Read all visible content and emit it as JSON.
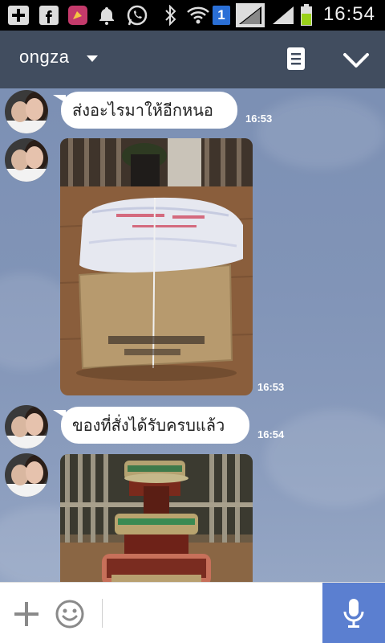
{
  "status_bar": {
    "time": "16:54",
    "notification_badge": "1",
    "icons": [
      "add-icon",
      "facebook-icon",
      "app-icon",
      "bell-icon",
      "whatsapp-icon",
      "bluetooth-icon",
      "wifi-icon",
      "sim-badge-icon",
      "signal-icon",
      "signal-icon",
      "battery-icon"
    ]
  },
  "header": {
    "title": "ongza",
    "icons": [
      "chevron-down-icon",
      "notes-icon",
      "collapse-icon"
    ]
  },
  "messages": [
    {
      "type": "text",
      "text": "ส่งอะไรมาให้อีกหนอ",
      "time": "16:53"
    },
    {
      "type": "image",
      "description_icon": "package-photo",
      "time": "16:53"
    },
    {
      "type": "text",
      "text": "ของที่สั่งได้รับครบแล้ว",
      "time": "16:54"
    },
    {
      "type": "image",
      "description_icon": "tray-photo",
      "time": ""
    }
  ],
  "input_bar": {
    "placeholder": "",
    "icons": [
      "plus-icon",
      "emoji-icon",
      "mic-icon"
    ]
  },
  "colors": {
    "status_bar": "#000000",
    "header": "#414d5f",
    "chat_background": "#7f93b6",
    "mic_button": "#5b7fd0"
  }
}
